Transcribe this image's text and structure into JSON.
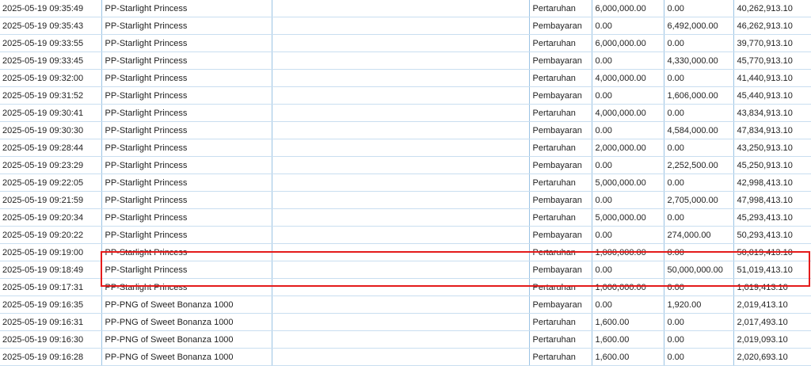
{
  "rows": [
    {
      "time": "2025-05-19 09:35:49",
      "game": "PP-Starlight Princess",
      "type": "Pertaruhan",
      "bet": "6,000,000.00",
      "win": "0.00",
      "balance": "40,262,913.10"
    },
    {
      "time": "2025-05-19 09:35:43",
      "game": "PP-Starlight Princess",
      "type": "Pembayaran",
      "bet": "0.00",
      "win": "6,492,000.00",
      "balance": "46,262,913.10"
    },
    {
      "time": "2025-05-19 09:33:55",
      "game": "PP-Starlight Princess",
      "type": "Pertaruhan",
      "bet": "6,000,000.00",
      "win": "0.00",
      "balance": "39,770,913.10"
    },
    {
      "time": "2025-05-19 09:33:45",
      "game": "PP-Starlight Princess",
      "type": "Pembayaran",
      "bet": "0.00",
      "win": "4,330,000.00",
      "balance": "45,770,913.10"
    },
    {
      "time": "2025-05-19 09:32:00",
      "game": "PP-Starlight Princess",
      "type": "Pertaruhan",
      "bet": "4,000,000.00",
      "win": "0.00",
      "balance": "41,440,913.10"
    },
    {
      "time": "2025-05-19 09:31:52",
      "game": "PP-Starlight Princess",
      "type": "Pembayaran",
      "bet": "0.00",
      "win": "1,606,000.00",
      "balance": "45,440,913.10"
    },
    {
      "time": "2025-05-19 09:30:41",
      "game": "PP-Starlight Princess",
      "type": "Pertaruhan",
      "bet": "4,000,000.00",
      "win": "0.00",
      "balance": "43,834,913.10"
    },
    {
      "time": "2025-05-19 09:30:30",
      "game": "PP-Starlight Princess",
      "type": "Pembayaran",
      "bet": "0.00",
      "win": "4,584,000.00",
      "balance": "47,834,913.10"
    },
    {
      "time": "2025-05-19 09:28:44",
      "game": "PP-Starlight Princess",
      "type": "Pertaruhan",
      "bet": "2,000,000.00",
      "win": "0.00",
      "balance": "43,250,913.10"
    },
    {
      "time": "2025-05-19 09:23:29",
      "game": "PP-Starlight Princess",
      "type": "Pembayaran",
      "bet": "0.00",
      "win": "2,252,500.00",
      "balance": "45,250,913.10"
    },
    {
      "time": "2025-05-19 09:22:05",
      "game": "PP-Starlight Princess",
      "type": "Pertaruhan",
      "bet": "5,000,000.00",
      "win": "0.00",
      "balance": "42,998,413.10"
    },
    {
      "time": "2025-05-19 09:21:59",
      "game": "PP-Starlight Princess",
      "type": "Pembayaran",
      "bet": "0.00",
      "win": "2,705,000.00",
      "balance": "47,998,413.10"
    },
    {
      "time": "2025-05-19 09:20:34",
      "game": "PP-Starlight Princess",
      "type": "Pertaruhan",
      "bet": "5,000,000.00",
      "win": "0.00",
      "balance": "45,293,413.10"
    },
    {
      "time": "2025-05-19 09:20:22",
      "game": "PP-Starlight Princess",
      "type": "Pembayaran",
      "bet": "0.00",
      "win": "274,000.00",
      "balance": "50,293,413.10"
    },
    {
      "time": "2025-05-19 09:19:00",
      "game": "PP-Starlight Princess",
      "type": "Pertaruhan",
      "bet": "1,000,000.00",
      "win": "0.00",
      "balance": "50,019,413.10"
    },
    {
      "time": "2025-05-19 09:18:49",
      "game": "PP-Starlight Princess",
      "type": "Pembayaran",
      "bet": "0.00",
      "win": "50,000,000.00",
      "balance": "51,019,413.10"
    },
    {
      "time": "2025-05-19 09:17:31",
      "game": "PP-Starlight Princess",
      "type": "Pertaruhan",
      "bet": "1,000,000.00",
      "win": "0.00",
      "balance": "1,019,413.10"
    },
    {
      "time": "2025-05-19 09:16:35",
      "game": "PP-PNG of Sweet Bonanza 1000",
      "type": "Pembayaran",
      "bet": "0.00",
      "win": "1,920.00",
      "balance": "2,019,413.10"
    },
    {
      "time": "2025-05-19 09:16:31",
      "game": "PP-PNG of Sweet Bonanza 1000",
      "type": "Pertaruhan",
      "bet": "1,600.00",
      "win": "0.00",
      "balance": "2,017,493.10"
    },
    {
      "time": "2025-05-19 09:16:30",
      "game": "PP-PNG of Sweet Bonanza 1000",
      "type": "Pertaruhan",
      "bet": "1,600.00",
      "win": "0.00",
      "balance": "2,019,093.10"
    },
    {
      "time": "2025-05-19 09:16:28",
      "game": "PP-PNG of Sweet Bonanza 1000",
      "type": "Pertaruhan",
      "bet": "1,600.00",
      "win": "0.00",
      "balance": "2,020,693.10"
    }
  ],
  "highlight": {
    "rows": [
      15,
      16
    ],
    "color": "#e41b1b"
  },
  "colors": {
    "grid": "#9cc4e4",
    "row_line": "#c9def0"
  }
}
